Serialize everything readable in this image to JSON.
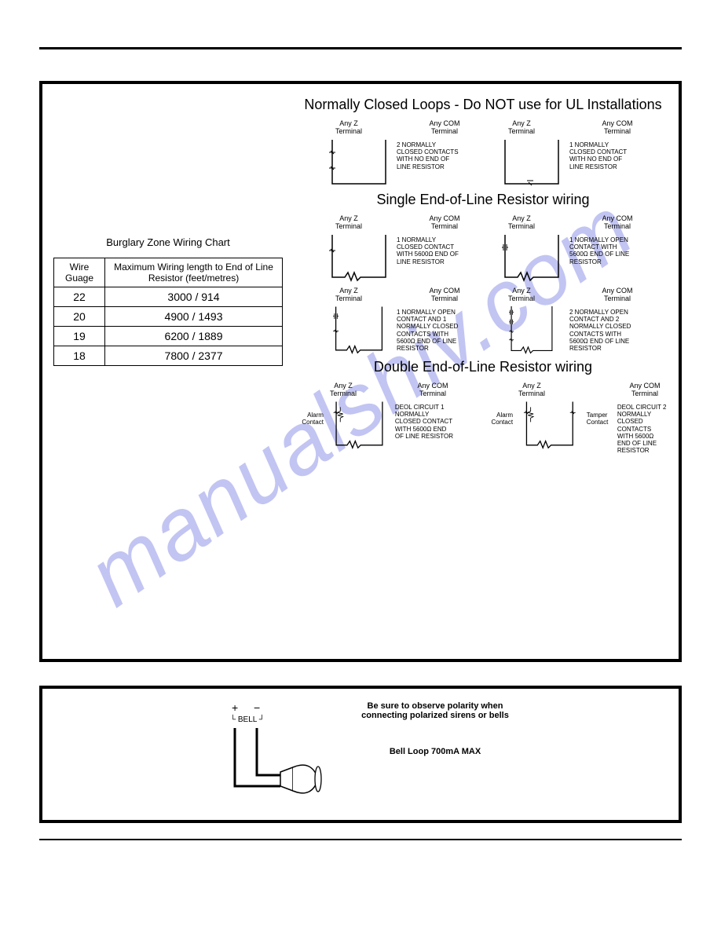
{
  "watermark": "manualshiv.com",
  "chart": {
    "title": "Burglary Zone Wiring Chart",
    "headers": [
      "Wire Guage",
      "Maximum Wiring length to End of Line Resistor (feet/metres)"
    ],
    "rows": [
      {
        "gauge": "22",
        "length": "3000 / 914"
      },
      {
        "gauge": "20",
        "length": "4900 / 1493"
      },
      {
        "gauge": "19",
        "length": "6200 / 1889"
      },
      {
        "gauge": "18",
        "length": "7800 / 2377"
      }
    ]
  },
  "sections": {
    "nc": {
      "title": "Normally Closed Loops - Do NOT use for UL Installations",
      "diagrams": [
        {
          "t1": "Any Z Terminal",
          "t2": "Any COM Terminal",
          "desc": "2 NORMALLY CLOSED CONTACTS WITH NO END OF LINE RESISTOR"
        },
        {
          "t1": "Any Z Terminal",
          "t2": "Any COM Terminal",
          "desc": "1 NORMALLY CLOSED CONTACT WITH NO END OF LINE RESISTOR"
        }
      ]
    },
    "seol": {
      "title": "Single End-of-Line Resistor wiring",
      "diagrams": [
        {
          "t1": "Any Z Terminal",
          "t2": "Any COM Terminal",
          "desc": "1 NORMALLY CLOSED CONTACT WITH 5600Ω END OF LINE RESISTOR"
        },
        {
          "t1": "Any Z Terminal",
          "t2": "Any COM Terminal",
          "desc": "1 NORMALLY OPEN CONTACT WITH 5600Ω END OF LINE RESISTOR"
        },
        {
          "t1": "Any Z Terminal",
          "t2": "Any COM Terminal",
          "desc": "1 NORMALLY OPEN CONTACT AND 1 NORMALLY CLOSED CONTACTS WITH 5600Ω END OF LINE RESISTOR"
        },
        {
          "t1": "Any Z Terminal",
          "t2": "Any COM Terminal",
          "desc": "2 NORMALLY OPEN CONTACT AND 2 NORMALLY CLOSED CONTACTS WITH 5600Ω END OF LINE RESISTOR"
        }
      ]
    },
    "deol": {
      "title": "Double End-of-Line Resistor wiring",
      "diagrams": [
        {
          "side": "Alarm Contact",
          "t1": "Any Z Terminal",
          "t2": "Any COM Terminal",
          "desc": "DEOL CIRCUIT 1 NORMALLY CLOSED CONTACT WITH 5600Ω END OF LINE RESISTOR"
        },
        {
          "side": "Alarm Contact",
          "side2": "Tamper Contact",
          "t1": "Any Z Terminal",
          "t2": "Any COM Terminal",
          "desc": "DEOL CIRCUIT 2 NORMALLY CLOSED CONTACTS WITH 5600Ω END OF LINE RESISTOR"
        }
      ]
    }
  },
  "bell": {
    "plus": "+",
    "minus": "−",
    "bell_label": "BELL",
    "polarity_note": "Be sure to observe polarity when connecting polarized sirens or bells",
    "loop_label": "Bell Loop 700mA MAX"
  }
}
